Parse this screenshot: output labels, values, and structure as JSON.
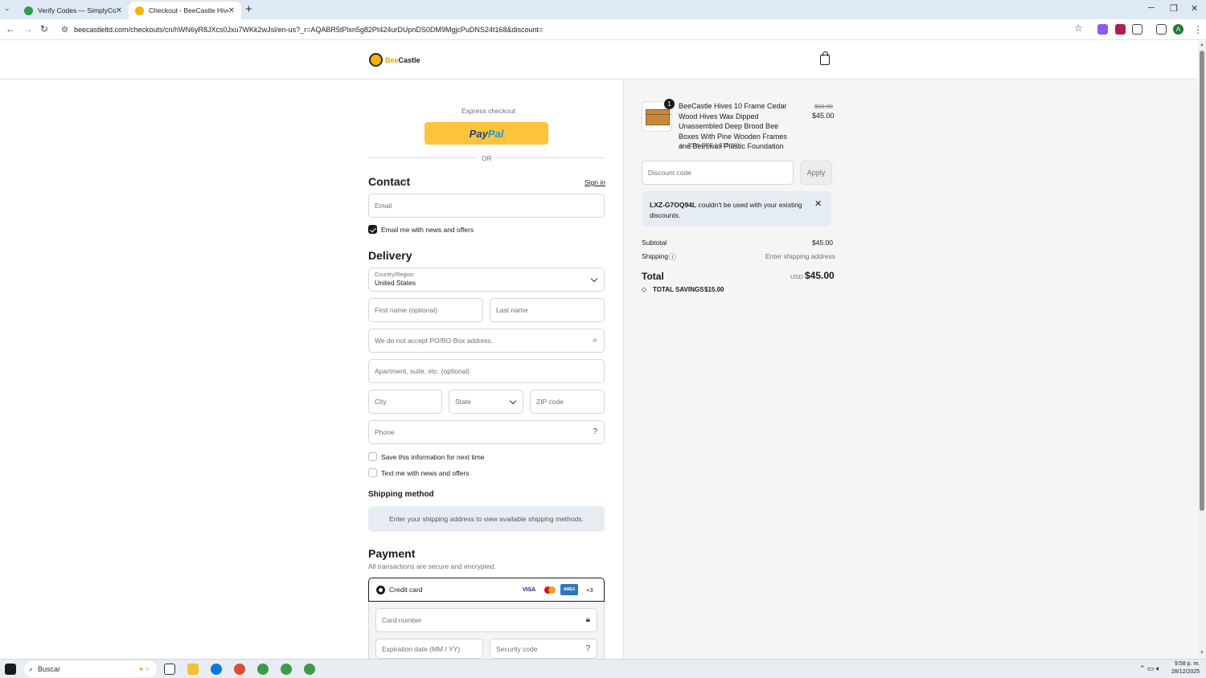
{
  "browser": {
    "tabs": [
      {
        "title": "Verify Codes — SimplyCodes",
        "active": false
      },
      {
        "title": "Checkout - BeeCastle Hives",
        "active": true
      }
    ],
    "url": "beecastleltd.com/checkouts/cn/hWN6yR8JXcs0Jxu7WKk2wJsl/en-us?_r=AQABR5tPlxn5g82Pt424urDUpnDS0DM9MgjcPuDNS24t168&discount=",
    "profile_initial": "A"
  },
  "store": {
    "logo_word1": "Bee",
    "logo_word2": "Castle"
  },
  "express": {
    "label": "Express checkout",
    "paypal_pay": "Pay",
    "paypal_pal": "Pal",
    "or": "OR"
  },
  "contact": {
    "heading": "Contact",
    "sign_in": "Sign in",
    "email_placeholder": "Email",
    "newsletter_label": "Email me with news and offers",
    "newsletter_checked": true
  },
  "delivery": {
    "heading": "Delivery",
    "country_label": "Country/Region",
    "country_value": "United States",
    "first_name": "First name (optional)",
    "last_name": "Last name",
    "address": "We do not accept PO/BO Box address.",
    "apartment": "Apartment, suite, etc. (optional)",
    "city": "City",
    "state": "State",
    "zip": "ZIP code",
    "phone": "Phone",
    "save_info": "Save this information for next time",
    "text_me": "Text me with news and offers"
  },
  "shipping_method": {
    "heading": "Shipping method",
    "info": "Enter your shipping address to view available shipping methods."
  },
  "payment": {
    "heading": "Payment",
    "subtitle": "All transactions are secure and encrypted.",
    "credit_card": "Credit card",
    "cards": [
      "VISA",
      "MC",
      "AMEX"
    ],
    "more_cards": "+3",
    "card_number": "Card number",
    "expiration": "Expiration date (MM / YY)",
    "security_code": "Security code"
  },
  "order": {
    "quantity": "1",
    "product_name": "BeeCastle Hives 10 Frame Cedar Wood Hives Wax Dipped Unassembled Deep Brood Bee Boxes With Pine Wooden Frames and Beeswax Plastic Foundation",
    "discount_tag": "25% OFF (-$15.00)",
    "original_price": "$60.00",
    "price": "$45.00",
    "discount_placeholder": "Discount code",
    "apply": "Apply",
    "alert_code": "LXZ-G7OQ94L",
    "alert_text": " couldn't be used with your existing discounts.",
    "subtotal_label": "Subtotal",
    "subtotal": "$45.00",
    "shipping_label": "Shipping",
    "shipping_value": "Enter shipping address",
    "total_label": "Total",
    "currency": "USD",
    "total": "$45.00",
    "savings_label": "TOTAL SAVINGS",
    "savings": "$15.00"
  },
  "taskbar": {
    "search": "Buscar",
    "time": "9:58 p. m.",
    "date": "28/12/2025"
  },
  "colors": {
    "paypal": "#ffc439",
    "accent": "#1a1a1a",
    "brand": "#f1b400"
  }
}
